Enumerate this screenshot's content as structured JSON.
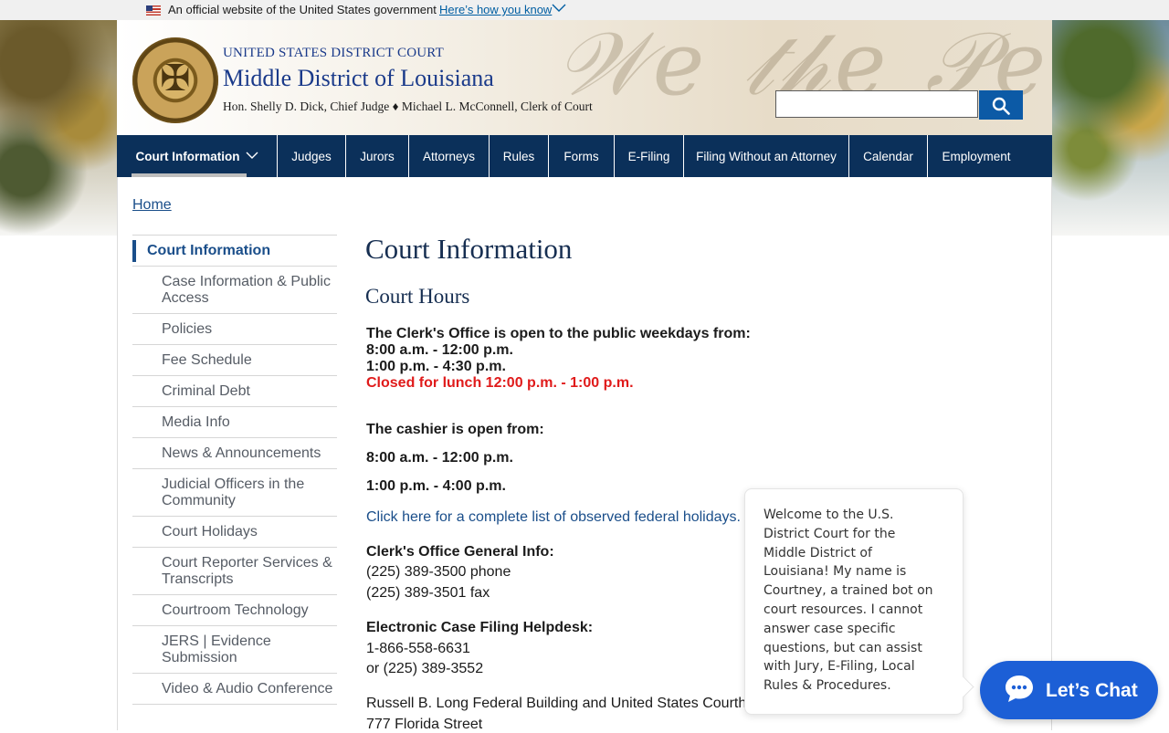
{
  "banner": {
    "official_text": "An official website of the United States government",
    "how_you_know": "Here’s how you know"
  },
  "header": {
    "court_sup": "UNITED STATES DISTRICT COURT",
    "court_name": "Middle District of Louisiana",
    "officers": "Hon. Shelly D. Dick, Chief Judge ♦ Michael L. McConnell, Clerk of Court",
    "search_placeholder": ""
  },
  "nav": {
    "items": [
      {
        "label": "Court Information"
      },
      {
        "label": "Judges"
      },
      {
        "label": "Jurors"
      },
      {
        "label": "Attorneys"
      },
      {
        "label": "Rules"
      },
      {
        "label": "Forms"
      },
      {
        "label": "E-Filing"
      },
      {
        "label": "Filing Without an Attorney"
      },
      {
        "label": "Calendar"
      },
      {
        "label": "Employment"
      }
    ]
  },
  "breadcrumb": {
    "home": "Home"
  },
  "sidebar": {
    "title": "Court Information",
    "items": [
      {
        "label": "Case Information & Public Access"
      },
      {
        "label": "Policies"
      },
      {
        "label": "Fee Schedule"
      },
      {
        "label": "Criminal Debt"
      },
      {
        "label": "Media Info"
      },
      {
        "label": "News & Announcements"
      },
      {
        "label": "Judicial Officers in the Community"
      },
      {
        "label": "Court Holidays"
      },
      {
        "label": "Court Reporter Services & Transcripts"
      },
      {
        "label": "Courtroom Technology"
      },
      {
        "label": "JERS | Evidence Submission"
      },
      {
        "label": "Video & Audio Conference"
      }
    ]
  },
  "content": {
    "title": "Court Information",
    "subtitle": "Court Hours",
    "clerk_open": "The Clerk's Office is open to the public weekdays from:",
    "clerk_h1": "8:00 a.m. - 12:00 p.m.",
    "clerk_h2": "1:00 p.m. - 4:30 p.m.",
    "lunch": "Closed for lunch 12:00 p.m. - 1:00 p.m.",
    "cashier_open": "The cashier is open from:",
    "cashier_h1": "8:00 a.m. - 12:00 p.m.",
    "cashier_h2": "1:00 p.m. - 4:00 p.m.",
    "holidays_link": "Click here for a complete list of observed federal holidays.",
    "clerk_info_title": "Clerk's Office General Info:",
    "clerk_phone": "(225) 389-3500 phone",
    "clerk_fax": "(225) 389-3501 fax",
    "helpdesk_title": "Electronic Case Filing Helpdesk:",
    "helpdesk_phone1": "1-866-558-6631",
    "helpdesk_phone2": "or (225) 389-3552",
    "address1": "Russell B. Long Federal Building and United States Courth",
    "address2": "777 Florida Street"
  },
  "chat": {
    "lines": [
      "Welcome to the U.S.",
      "District Court for the",
      "Middle District of",
      "Louisiana! My name is",
      "Courtney, a trained bot on",
      "court resources. I cannot",
      "answer case specific",
      "questions, but can assist",
      "with Jury, E-Filing, Local",
      "Rules & Procedures."
    ],
    "button_label": "Let’s Chat"
  },
  "colors": {
    "nav_bg": "#0b305a",
    "link": "#1a4e8a",
    "alert_red": "#e01b1b",
    "chat_blue": "#1c5fd6"
  }
}
